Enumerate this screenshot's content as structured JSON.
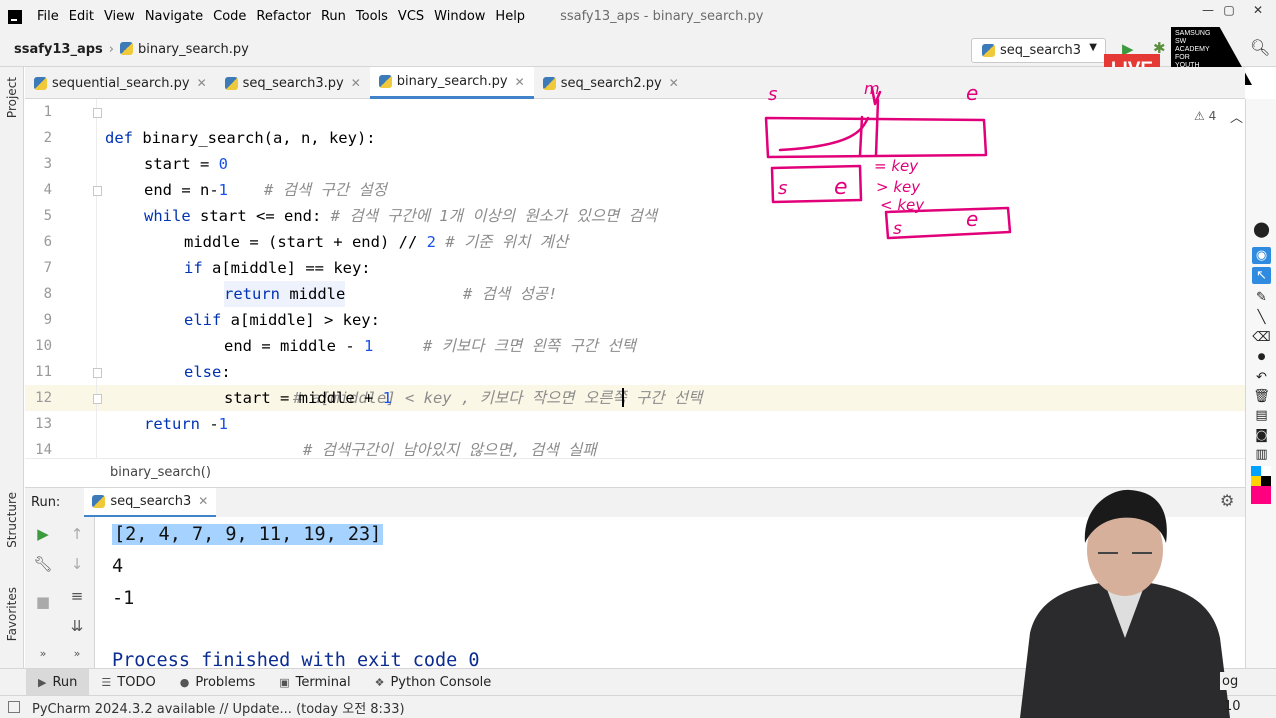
{
  "menu": {
    "items": [
      "File",
      "Edit",
      "View",
      "Navigate",
      "Code",
      "Refactor",
      "Run",
      "Tools",
      "VCS",
      "Window",
      "Help"
    ],
    "window_title": "ssafy13_aps - binary_search.py",
    "controls": [
      "—",
      "▢",
      "✕"
    ]
  },
  "navbar": {
    "project": "ssafy13_aps",
    "file": "binary_search.py",
    "run_config": "seq_search3",
    "run_icon": "play-icon",
    "debug_icon": "bug-icon",
    "search_icon": "search-icon"
  },
  "overlay": {
    "live": "LIVE",
    "academy": [
      "SAMSUNG",
      "SW",
      "ACADEMY",
      "FOR",
      "YOUTH"
    ]
  },
  "left_strip": {
    "project_label": "Project",
    "structure_label": "Structure",
    "favorites_label": "Favorites"
  },
  "tabs": [
    {
      "label": "sequential_search.py",
      "active": false
    },
    {
      "label": "seq_search3.py",
      "active": false
    },
    {
      "label": "binary_search.py",
      "active": true
    },
    {
      "label": "seq_search2.py",
      "active": false
    }
  ],
  "editor": {
    "line_numbers": [
      "1",
      "2",
      "3",
      "4",
      "5",
      "6",
      "7",
      "8",
      "9",
      "10",
      "11",
      "12",
      "13",
      "14"
    ],
    "inspection_count": "4",
    "current_line": "12",
    "lines": {
      "l1": {
        "kw": "def",
        "text": " binary_search(a, n, key):"
      },
      "l2": {
        "code": "start = ",
        "num": "0",
        "comment": "# 검색 구간 설정"
      },
      "l3": {
        "code": "end = n-",
        "num": "1"
      },
      "l4": {
        "kw": "while",
        "code": " start <= end:",
        "comment": " # 검색 구간에 1개 이상의 원소가 있으면 검색"
      },
      "l5": {
        "code": "middle = (start + end) // ",
        "num": "2",
        "comment": " # 기준 위치 계산"
      },
      "l6": {
        "kw": "if",
        "code": " a[middle] == key:",
        "comment": "# 검색 성공!"
      },
      "l7": {
        "kw": "return",
        "code": " middle"
      },
      "l8": {
        "kw": "elif",
        "code": " a[middle] > key:",
        "comment": "# 키보다 크면 왼쪽 구간 선택"
      },
      "l9": {
        "code": "end = middle - ",
        "num": "1"
      },
      "l10": {
        "kw": "else",
        "code": ":",
        "comment": "# a[middle] < key , 키보다 작으면 오른쪽 구간 선택"
      },
      "l11": {
        "code": "start = middle + ",
        "num": "1"
      },
      "l12": {
        "kw": "return",
        "code": " -",
        "num": "1",
        "comment": "# 검색구간이 남아있지 않으면, 검색 실패"
      }
    }
  },
  "breadcrumb": {
    "function": "binary_search()"
  },
  "run_panel": {
    "label": "Run:",
    "tab": "seq_search3",
    "output": [
      "[2, 4, 7, 9, 11, 19, 23]",
      "4",
      "-1",
      "Process finished with exit code 0"
    ],
    "toolbar_icons": [
      "play-icon",
      "up-arrow-icon",
      "wrench-icon",
      "down-arrow-icon",
      "stop-icon",
      "soft-wrap-icon",
      "scroll-to-end-icon",
      "more-icon",
      "more-icon"
    ]
  },
  "bottom_tools": [
    {
      "label": "Run",
      "active": true
    },
    {
      "label": "TODO",
      "active": false
    },
    {
      "label": "Problems",
      "active": false
    },
    {
      "label": "Terminal",
      "active": false
    },
    {
      "label": "Python Console",
      "active": false
    }
  ],
  "status": {
    "message": "PyCharm 2024.3.2 available // Update... (today 오전 8:33)",
    "right_partial_1": "og",
    "right_partial_2": "10"
  },
  "annotations": {
    "labels": [
      "s",
      "m",
      "e",
      "s",
      "e",
      "= key",
      "> key",
      "< key",
      "s",
      "e"
    ],
    "ink_color": "#e2007a"
  },
  "colors": {
    "keyword": "#0033b3",
    "number": "#1750eb",
    "comment": "#8c8c8c",
    "selection": "#a6d2ff",
    "tab_underline": "#4083c9",
    "live_red": "#e53935"
  }
}
